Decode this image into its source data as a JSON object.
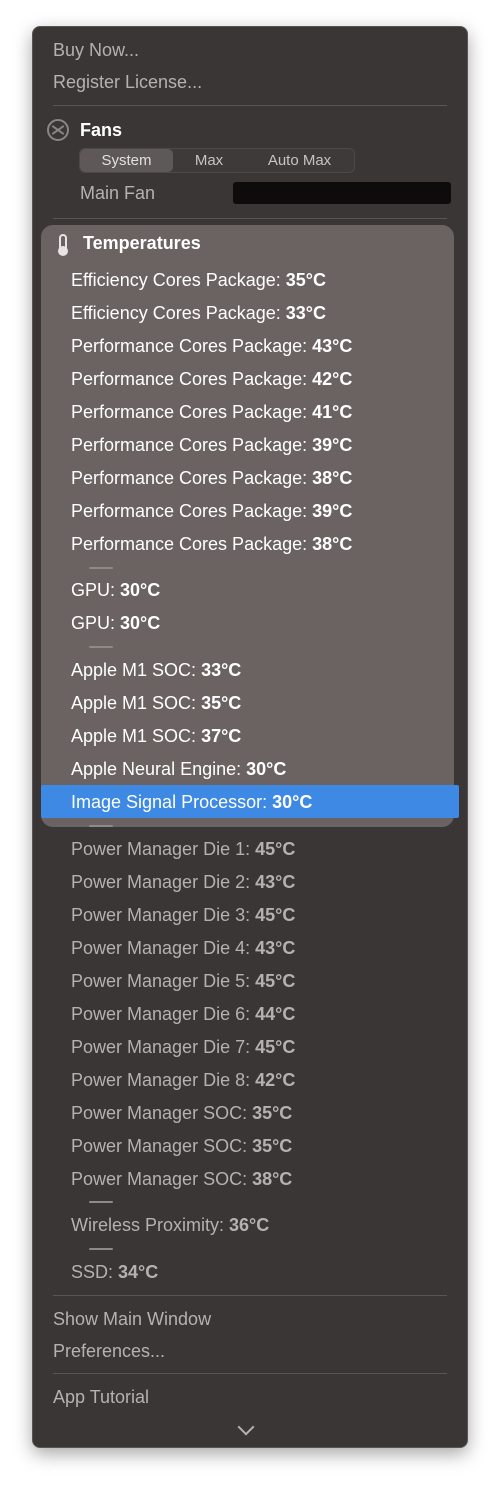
{
  "menu": {
    "top_items": [
      "Buy Now...",
      "Register License..."
    ],
    "fans": {
      "title": "Fans",
      "icon": "fan-icon",
      "modes": [
        "System",
        "Max",
        "Auto Max"
      ],
      "selected_mode": "System",
      "main_fan_label": "Main Fan"
    },
    "temperatures": {
      "title": "Temperatures",
      "icon": "thermometer-icon",
      "sensors": [
        {
          "name": "Efficiency Cores Package: ",
          "value": "35°C"
        },
        {
          "name": "Efficiency Cores Package: ",
          "value": "33°C"
        },
        {
          "name": "Performance Cores Package: ",
          "value": "43°C"
        },
        {
          "name": "Performance Cores Package: ",
          "value": "42°C"
        },
        {
          "name": "Performance Cores Package: ",
          "value": "41°C"
        },
        {
          "name": "Performance Cores Package: ",
          "value": "39°C"
        },
        {
          "name": "Performance Cores Package: ",
          "value": "38°C"
        },
        {
          "name": "Performance Cores Package: ",
          "value": "39°C"
        },
        {
          "name": "Performance Cores Package: ",
          "value": "38°C"
        },
        {
          "name": "GPU: ",
          "value": "30°C"
        },
        {
          "name": "GPU: ",
          "value": "30°C"
        },
        {
          "name": "Apple M1 SOC: ",
          "value": "33°C"
        },
        {
          "name": "Apple M1 SOC: ",
          "value": "35°C"
        },
        {
          "name": "Apple M1 SOC: ",
          "value": "37°C"
        },
        {
          "name": "Apple Neural Engine: ",
          "value": "30°C"
        },
        {
          "name": "Image Signal Processor: ",
          "value": "30°C"
        },
        {
          "name": "Power Manager Die 1: ",
          "value": "45°C"
        },
        {
          "name": "Power Manager Die 2: ",
          "value": "43°C"
        },
        {
          "name": "Power Manager Die 3: ",
          "value": "45°C"
        },
        {
          "name": "Power Manager Die 4: ",
          "value": "43°C"
        },
        {
          "name": "Power Manager Die 5: ",
          "value": "45°C"
        },
        {
          "name": "Power Manager Die 6: ",
          "value": "44°C"
        },
        {
          "name": "Power Manager Die 7: ",
          "value": "45°C"
        },
        {
          "name": "Power Manager Die 8: ",
          "value": "42°C"
        },
        {
          "name": "Power Manager SOC: ",
          "value": "35°C"
        },
        {
          "name": "Power Manager SOC: ",
          "value": "35°C"
        },
        {
          "name": "Power Manager SOC: ",
          "value": "38°C"
        },
        {
          "name": "Wireless Proximity: ",
          "value": "36°C"
        },
        {
          "name": "SSD: ",
          "value": "34°C"
        }
      ],
      "highlighted_sensor": "Image Signal Processor"
    },
    "bottom_items": [
      "Show Main Window",
      "Preferences...",
      "App Tutorial"
    ],
    "more_icon": "chevron-down-icon"
  },
  "colors": {
    "menu_background": "#3b3636",
    "panel_background": "#6b6361",
    "highlight": "#3d89e3",
    "text_dim": "#b6b1b1"
  }
}
